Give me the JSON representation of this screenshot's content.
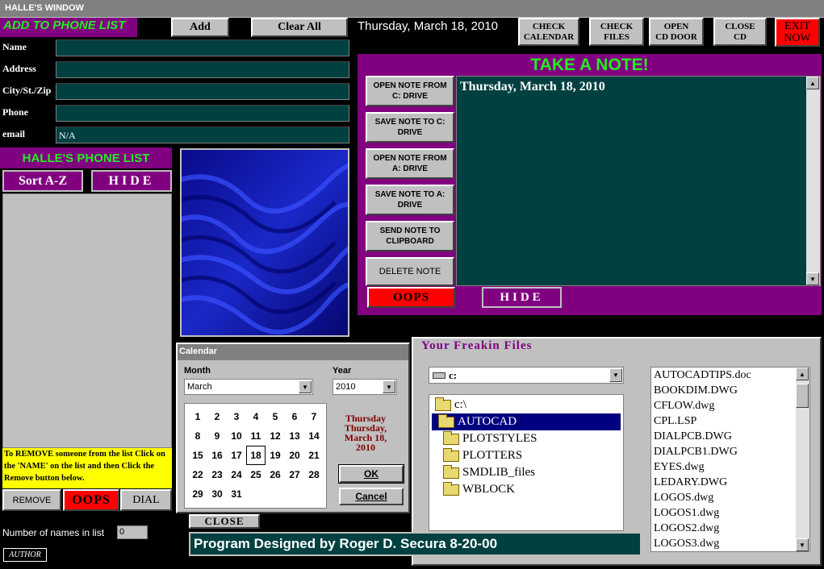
{
  "window_title": "HALLE'S WINDOW",
  "add_section": {
    "title": "ADD TO PHONE LIST",
    "labels": {
      "name": "Name",
      "address": "Address",
      "city": "City/St./Zip",
      "phone": "Phone",
      "email": "email"
    },
    "values": {
      "name": "",
      "address": "",
      "city": "",
      "phone": "",
      "email": "N/A"
    }
  },
  "toolbar": {
    "add": "Add",
    "clear_all": "Clear All",
    "date": "Thursday, March 18, 2010",
    "check_calendar": [
      "CHECK",
      "CALENDAR"
    ],
    "check_files": [
      "CHECK",
      "FILES"
    ],
    "open_cd": [
      "OPEN",
      "CD DOOR"
    ],
    "close_cd": [
      "CLOSE",
      "CD"
    ],
    "exit": [
      "EXIT",
      "NOW"
    ]
  },
  "phone_list": {
    "title": "HALLE'S PHONE LIST",
    "sort": "Sort A-Z",
    "hide": "HIDE",
    "help": "To REMOVE someone from the list Click on the 'NAME' on the list and then Click the Remove button below.",
    "remove": "REMOVE",
    "oops": "OOPS",
    "dial": "DIAL",
    "count_label": "Number of names in list",
    "count_value": "0",
    "author": "AUTHOR"
  },
  "note": {
    "title": "TAKE A NOTE!",
    "buttons": {
      "open_c": "OPEN NOTE  FROM C: DRIVE",
      "save_c": "SAVE NOTE   TO C: DRIVE",
      "open_a": "OPEN NOTE  FROM A: DRIVE",
      "save_a": "SAVE NOTE  TO A: DRIVE",
      "clipboard": "SEND NOTE TO CLIPBOARD",
      "delete": "DELETE NOTE"
    },
    "text": "Thursday, March 18, 2010",
    "oops": "OOPS",
    "hide": "HIDE"
  },
  "calendar": {
    "title": "Calendar",
    "month_label": "Month",
    "month_value": "March",
    "year_label": "Year",
    "year_value": "2010",
    "days": [
      [
        "1",
        "2",
        "3",
        "4",
        "5",
        "6",
        "7"
      ],
      [
        "8",
        "9",
        "10",
        "11",
        "12",
        "13",
        "14"
      ],
      [
        "15",
        "16",
        "17",
        "18",
        "19",
        "20",
        "21"
      ],
      [
        "22",
        "23",
        "24",
        "25",
        "26",
        "27",
        "28"
      ],
      [
        "29",
        "30",
        "31",
        "",
        "",
        "",
        ""
      ]
    ],
    "selected_day": "18",
    "display_lines": [
      "Thursday",
      "Thursday,",
      "March 18,",
      "2010"
    ],
    "ok": "OK",
    "cancel": "Cancel",
    "close": "CLOSE"
  },
  "files": {
    "title": "Your Freakin Files",
    "drive": "c:",
    "folders": [
      {
        "name": "c:\\",
        "open": true,
        "indent": 0
      },
      {
        "name": "AUTOCAD",
        "open": true,
        "indent": 0,
        "selected": true
      },
      {
        "name": "PLOTSTYLES",
        "open": false,
        "indent": 1
      },
      {
        "name": "PLOTTERS",
        "open": false,
        "indent": 1
      },
      {
        "name": "SMDLIB_files",
        "open": false,
        "indent": 1
      },
      {
        "name": "WBLOCK",
        "open": false,
        "indent": 1
      }
    ],
    "list": [
      "AUTOCADTIPS.doc",
      "BOOKDIM.DWG",
      "CFLOW.dwg",
      "CPL.LSP",
      "DIALPCB.DWG",
      "DIALPCB1.DWG",
      "EYES.dwg",
      "LEDARY.DWG",
      "LOGOS.dwg",
      "LOGOS1.dwg",
      "LOGOS2.dwg",
      "LOGOS3.dwg"
    ]
  },
  "footer": "Program Designed by Roger D. Secura 8-20-00",
  "colors": {
    "accent_green": "#22ee22",
    "purple": "#800080",
    "teal": "#004040",
    "exit_red": "#ff0000"
  }
}
